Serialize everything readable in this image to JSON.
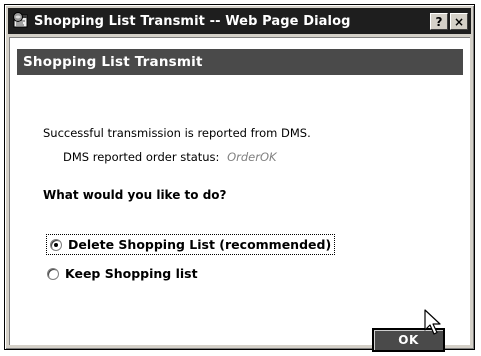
{
  "window": {
    "title": "Shopping List Transmit -- Web Page Dialog",
    "help_label": "?",
    "close_label": "×"
  },
  "header": {
    "title": "Shopping List Transmit"
  },
  "message": {
    "text": "Successful transmission is reported from DMS.",
    "status_label": "DMS reported order status:",
    "status_value": "OrderOK"
  },
  "question": "What would you like to do?",
  "options": [
    {
      "label": "Delete Shopping List (recommended)",
      "selected": true
    },
    {
      "label": "Keep Shopping list",
      "selected": false
    }
  ],
  "ok_button": {
    "label": "OK"
  }
}
